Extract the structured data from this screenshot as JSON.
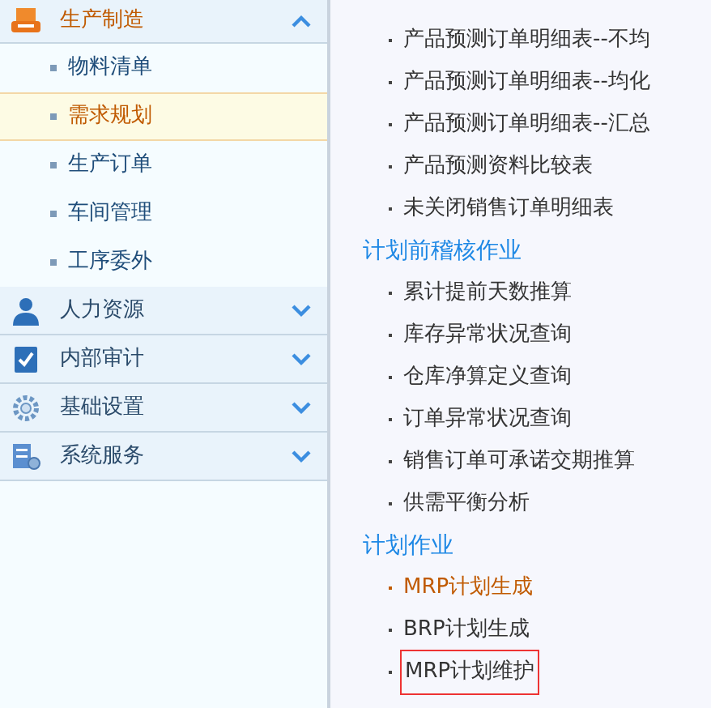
{
  "sidebar": {
    "groups": [
      {
        "label": "生产制造",
        "expanded": true,
        "items": [
          {
            "label": "物料清单",
            "selected": false
          },
          {
            "label": "需求规划",
            "selected": true
          },
          {
            "label": "生产订单",
            "selected": false
          },
          {
            "label": "车间管理",
            "selected": false
          },
          {
            "label": "工序委外",
            "selected": false
          }
        ]
      },
      {
        "label": "人力资源",
        "expanded": false
      },
      {
        "label": "内部审计",
        "expanded": false
      },
      {
        "label": "基础设置",
        "expanded": false
      },
      {
        "label": "系统服务",
        "expanded": false
      }
    ]
  },
  "content": {
    "sections": [
      {
        "items": [
          {
            "label": "产品预测订单明细表--不均",
            "current": false,
            "outlined": false
          },
          {
            "label": "产品预测订单明细表--均化",
            "current": false,
            "outlined": false
          },
          {
            "label": "产品预测订单明细表--汇总",
            "current": false,
            "outlined": false
          },
          {
            "label": "产品预测资料比较表",
            "current": false,
            "outlined": false
          },
          {
            "label": "未关闭销售订单明细表",
            "current": false,
            "outlined": false
          }
        ]
      },
      {
        "title": "计划前稽核作业",
        "items": [
          {
            "label": "累计提前天数推算",
            "current": false,
            "outlined": false
          },
          {
            "label": "库存异常状况查询",
            "current": false,
            "outlined": false
          },
          {
            "label": "仓库净算定义查询",
            "current": false,
            "outlined": false
          },
          {
            "label": "订单异常状况查询",
            "current": false,
            "outlined": false
          },
          {
            "label": "销售订单可承诺交期推算",
            "current": false,
            "outlined": false
          },
          {
            "label": "供需平衡分析",
            "current": false,
            "outlined": false
          }
        ]
      },
      {
        "title": "计划作业",
        "items": [
          {
            "label": "MRP计划生成",
            "current": true,
            "outlined": false
          },
          {
            "label": "BRP计划生成",
            "current": false,
            "outlined": false
          },
          {
            "label": "MRP计划维护",
            "current": false,
            "outlined": true
          }
        ]
      }
    ]
  }
}
